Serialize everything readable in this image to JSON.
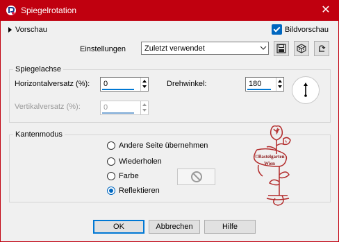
{
  "window": {
    "title": "Spiegelrotation",
    "close_glyph": "✕"
  },
  "header": {
    "preview_label": "Vorschau",
    "bildvorschau_label": "Bildvorschau",
    "bildvorschau_checked": true,
    "settings_label": "Einstellungen",
    "settings_value": "Zuletzt verwendet",
    "icon_buttons": [
      "save-preset-icon",
      "randomize-icon",
      "reset-icon"
    ]
  },
  "mirror_axis": {
    "group_title": "Spiegelachse",
    "horizontal_label": "Horizontalversatz (%):",
    "horizontal_value": "0",
    "vertical_label": "Vertikalversatz (%):",
    "vertical_value": "0",
    "rotation_label": "Drehwinkel:",
    "rotation_value": "180"
  },
  "edge_mode": {
    "group_title": "Kantenmodus",
    "options": [
      {
        "label": "Andere Seite übernehmen",
        "selected": false
      },
      {
        "label": "Wiederholen",
        "selected": false
      },
      {
        "label": "Farbe",
        "selected": false
      },
      {
        "label": "Reflektieren",
        "selected": true
      }
    ]
  },
  "watermark": {
    "line1": "©Bastelgarten",
    "line2": "Wien"
  },
  "buttons": {
    "ok": "OK",
    "cancel": "Abbrechen",
    "help": "Hilfe"
  },
  "colors": {
    "titlebar": "#c0000f",
    "accent": "#0067c0",
    "watermark": "#b22a2a"
  }
}
